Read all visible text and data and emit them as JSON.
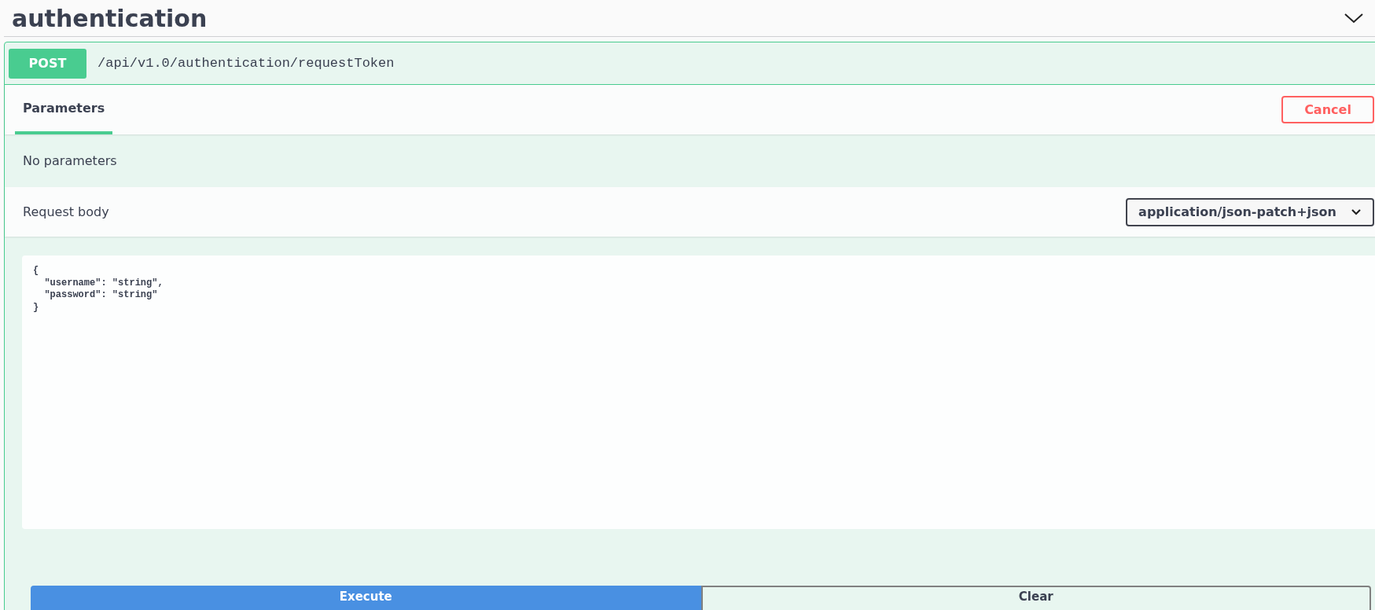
{
  "section": {
    "title": "authentication",
    "expanded": true
  },
  "operation": {
    "method": "POST",
    "path": "/api/v1.0/authentication/requestToken"
  },
  "tabs": [
    {
      "label": "Parameters",
      "selected": true
    }
  ],
  "cancel_button": "Cancel",
  "parameters_message": "No parameters",
  "request_body": {
    "label": "Request body",
    "content_type": "application/json-patch+json",
    "value": "{\n  \"username\": \"string\",\n  \"password\": \"string\"\n}"
  },
  "buttons": [
    {
      "label": "Execute",
      "kind": "primary"
    },
    {
      "label": "Clear",
      "kind": "secondary"
    }
  ]
}
